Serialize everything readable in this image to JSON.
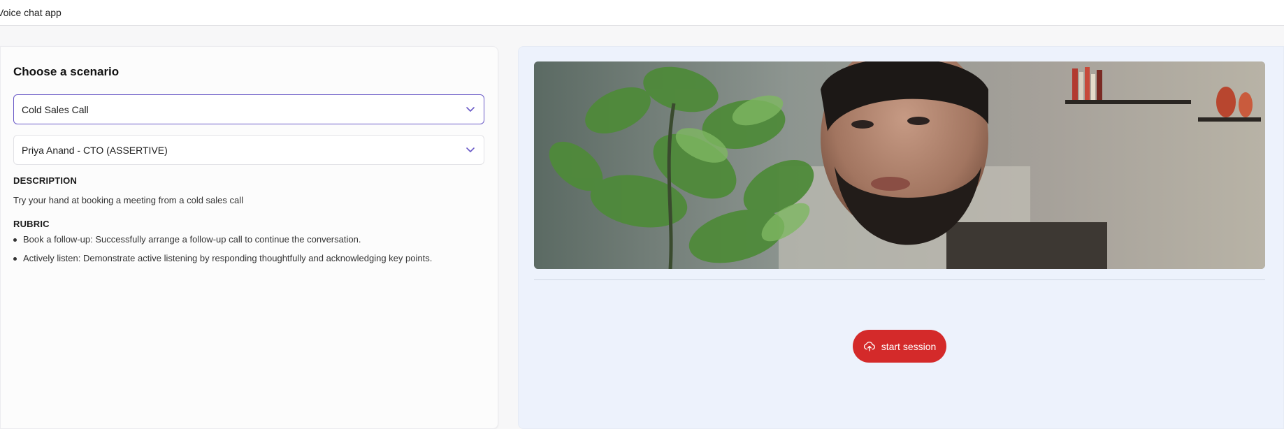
{
  "app": {
    "title": "Voice chat app"
  },
  "scenario_panel": {
    "heading": "Choose a scenario",
    "scenario_select": {
      "value": "Cold Sales Call",
      "icon": "chevron-down-icon"
    },
    "persona_select": {
      "value": "Priya Anand - CTO (ASSERTIVE)",
      "icon": "chevron-down-icon"
    },
    "description_label": "DESCRIPTION",
    "description_text": "Try your hand at booking a meeting from a cold sales call",
    "rubric_label": "RUBRIC",
    "rubric_items": [
      "Book a follow-up: Successfully arrange a follow-up call to continue the conversation.",
      "Actively listen: Demonstrate active listening by responding thoughtfully and acknowledging key points."
    ]
  },
  "session_panel": {
    "start_button": {
      "label": "start session",
      "icon": "cloud-upload-icon"
    }
  },
  "colors": {
    "accent_purple": "#6a5ac7",
    "start_red": "#d42a2a",
    "right_panel_bg": "#edf2fc"
  }
}
